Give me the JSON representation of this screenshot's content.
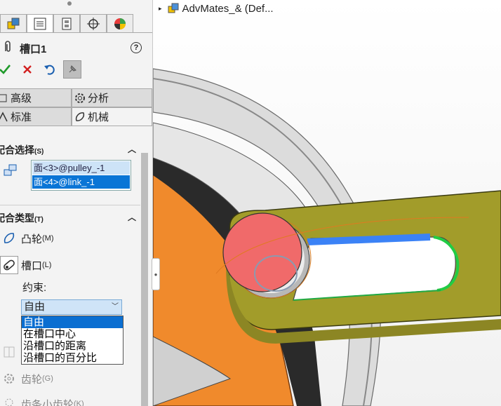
{
  "panel": {
    "tabs": [
      {
        "icon": "featuremanager-icon",
        "active": false
      },
      {
        "icon": "propertymanager-icon",
        "active": true
      },
      {
        "icon": "configurationmanager-icon",
        "active": false
      },
      {
        "icon": "dimxpert-icon",
        "active": false
      },
      {
        "icon": "display-manager-icon",
        "active": false
      }
    ],
    "title": "槽口1",
    "help_icon": "?",
    "mode_tabs": {
      "advanced": "高级",
      "analysis": "分析",
      "standard": "标准",
      "mechanical": "机械"
    },
    "mate_selection": {
      "header": "配合选择",
      "shortcut": "(S)",
      "items": [
        {
          "prefix": "面",
          "suffix": "<3>@pulley_-1"
        },
        {
          "prefix": "面",
          "suffix": "<4>@link_-1"
        }
      ]
    },
    "mate_type": {
      "header": "配合类型",
      "shortcut": "(T)",
      "cam_label": "凸轮",
      "cam_key": "(M)",
      "slot_label": "槽口",
      "slot_key": "(L)",
      "gear_label": "齿轮",
      "gear_key": "(G)",
      "rack_label": "齿条小齿轮",
      "rack_key": "(K)"
    },
    "constraint": {
      "label": "约束:",
      "value": "自由",
      "options": [
        "自由",
        "在槽口中心",
        "沿槽口的距离",
        "沿槽口的百分比"
      ],
      "selected_index": 0
    }
  },
  "tree": {
    "name": "AdvMates_& (Def..."
  },
  "colors": {
    "accent": "#0a75d6",
    "pulley": "#f28c28",
    "link": "#9e9a2c",
    "face": "#f26a6a",
    "wheel": "#dedede"
  }
}
